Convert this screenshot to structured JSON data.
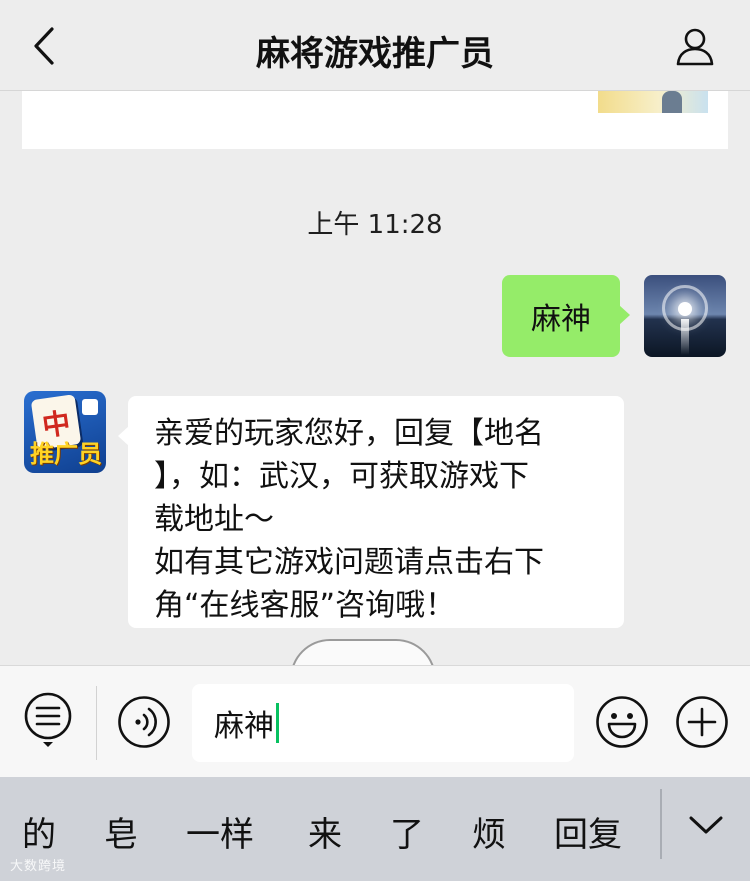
{
  "nav": {
    "title": "麻将游戏推广员",
    "back_icon": "chevron-left-icon",
    "profile_icon": "person-icon"
  },
  "chat": {
    "timestamp": "上午 11:28",
    "my_message": "麻神",
    "bot_avatar": {
      "tile_char": "中",
      "label": "推广员"
    },
    "bot_message_lines": [
      "亲爱的玩家您好，回复【地名",
      "】，如：武汉，可获取游戏下",
      "载地址～",
      "如有其它游戏问题请点击右下",
      "角“在线客服”咨询哦！"
    ]
  },
  "input_bar": {
    "menu_icon": "list-menu-icon",
    "voice_icon": "voice-icon",
    "text_value": "麻神",
    "emoji_icon": "emoji-icon",
    "plus_icon": "plus-icon",
    "caret_color": "#07c160"
  },
  "candidates": {
    "items": [
      "的",
      "皂",
      "一样",
      "来",
      "了",
      "烦",
      "回复"
    ],
    "collapse_icon": "chevron-down-icon"
  },
  "watermark": "大数跨境",
  "colors": {
    "my_bubble": "#95ec69",
    "background": "#ededed",
    "candidate_bar": "#cfd2d8"
  }
}
